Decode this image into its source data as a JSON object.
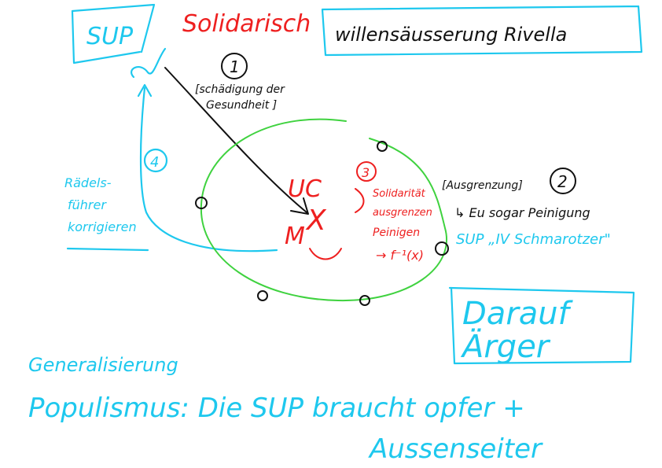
{
  "colors": {
    "cyan": "#1ec8ee",
    "red": "#ee2020",
    "green": "#3fd23f",
    "black": "#111111"
  },
  "sup_box": "SUP",
  "solidarisch": "Solidarisch",
  "willensaeusserung": "willensäusserung Rivella",
  "step1": {
    "number": "1",
    "label_line1": "[schädigung der",
    "label_line2": "Gesundheit ]"
  },
  "step2": {
    "number": "2",
    "label": "[Ausgrenzung]",
    "line2": "↳ Eu sogar Peinigung"
  },
  "step3": {
    "number": "3",
    "line1": "Solidarität",
    "line2": "ausgrenzen",
    "line3": "Peinigen",
    "line4": "→ f⁻¹(x)"
  },
  "step4": {
    "number": "4"
  },
  "center": {
    "uc": "UC",
    "m": "M",
    "x": "X"
  },
  "sup_schmarotzer": "SUP „IV Schmarotzer\"",
  "raedelsfuehrer": {
    "line1": "Rädels-",
    "line2": "führer",
    "line3": "korrigieren"
  },
  "darauf_box": {
    "line1": "Darauf",
    "line2": "Ärger"
  },
  "generalisierung": "Generalisierung",
  "populismus_line1": "Populismus: Die SUP braucht opfer +",
  "populismus_line2": "Aussenseiter"
}
